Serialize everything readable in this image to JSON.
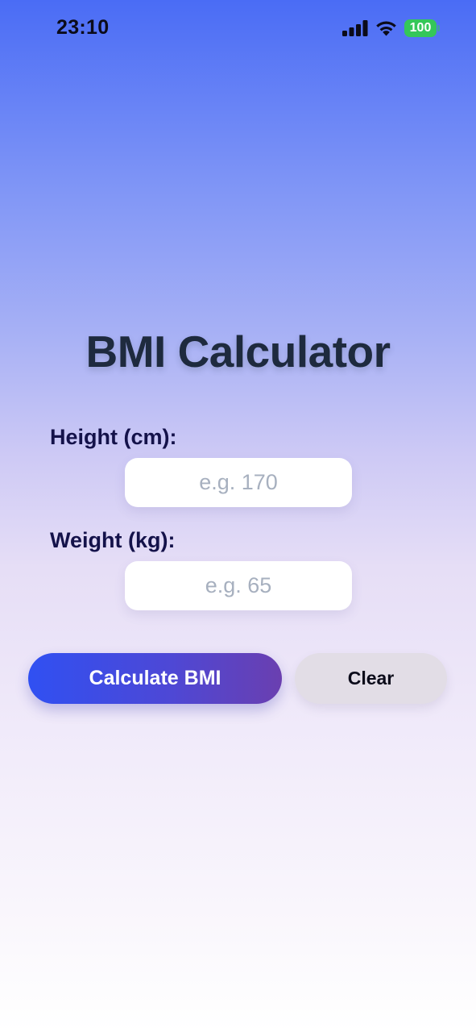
{
  "status_bar": {
    "time": "23:10",
    "battery": "100",
    "icons": [
      "signal-icon",
      "wifi-icon",
      "battery-icon"
    ],
    "battery_color": "#34c759"
  },
  "title": "BMI Calculator",
  "form": {
    "height": {
      "label": "Height (cm):",
      "value": "",
      "placeholder": "e.g. 170"
    },
    "weight": {
      "label": "Weight (kg):",
      "value": "",
      "placeholder": "e.g. 65"
    }
  },
  "buttons": {
    "calculate_label": "Calculate BMI",
    "clear_label": "Clear"
  },
  "colors": {
    "accent_gradient_start": "#3050f2",
    "accent_gradient_end": "#6a3fb0",
    "title": "#1e2a3e",
    "label": "#14124a"
  }
}
